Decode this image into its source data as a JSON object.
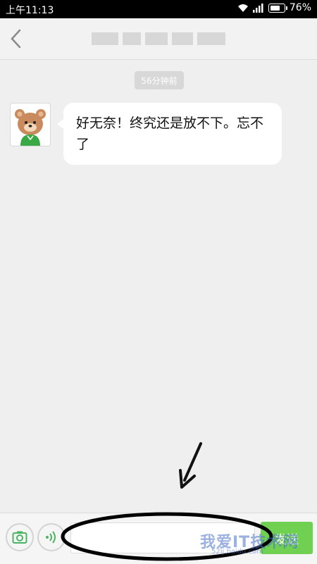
{
  "status_bar": {
    "time": "上午11:13",
    "battery": "76%"
  },
  "header": {
    "back_icon": "chevron-left-icon"
  },
  "chat": {
    "time_label": "56分钟前",
    "messages": [
      {
        "sender": "other",
        "text": "好无奈！终究还是放不下。忘不了"
      }
    ]
  },
  "input_bar": {
    "camera_icon": "camera-icon",
    "voice_icon": "voice-icon",
    "input_value": "",
    "send_label": "发送"
  },
  "watermark": {
    "text": "我爱IT技术网",
    "sub": "52ij.baidu.com"
  },
  "colors": {
    "send_green": "#6fd052",
    "background": "#efefef",
    "status_bar": "#000000"
  }
}
